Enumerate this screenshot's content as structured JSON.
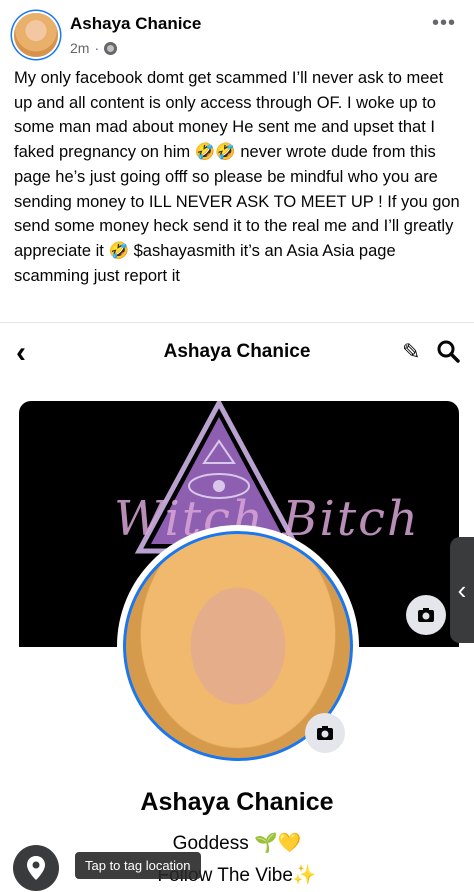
{
  "post": {
    "author": "Ashaya Chanice",
    "time": "2m",
    "separator": "·",
    "more_label": "•••",
    "text": "My only facebook domt get scammed I’ll never ask to meet up and all content is only access through OF. I woke up to some man mad about money He sent me and upset that I faked pregnancy on him 🤣🤣 never wrote dude from this page he’s just going offf so please be mindful who you are sending money to ILL NEVER ASK TO MEET UP ! If you gon send some money heck send it to the real me and I’ll greatly appreciate it 🤣 $ashayasmith it’s an Asia Asia page scamming just report it"
  },
  "screenshot": {
    "nav_back": "‹",
    "nav_title": "Ashaya Chanice",
    "nav_edit_icon": "✎",
    "cover_logo_text": "Witch Bitch",
    "side_tab_arrow": "‹",
    "profile_name": "Ashaya Chanice",
    "bio_line1": "Goddess 🌱💛",
    "bio_line2": "Follow The Vibe✨",
    "tag_tooltip": "Tap to tag location"
  },
  "colors": {
    "accent": "#1877f2",
    "cover_bg": "#000000",
    "triangle": "#8e5fb0",
    "text": "#050505",
    "muted": "#65676b"
  }
}
